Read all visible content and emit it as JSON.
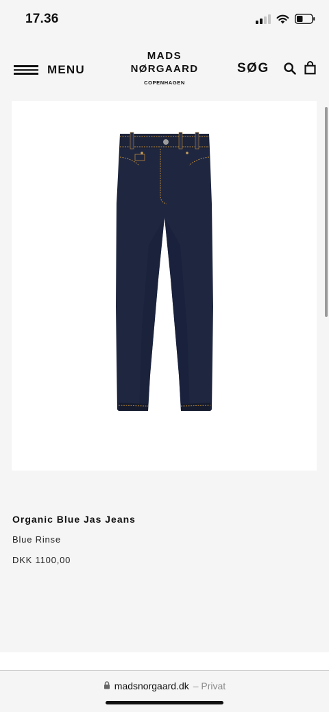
{
  "status": {
    "time": "17.36"
  },
  "header": {
    "menu_label": "MENU",
    "logo_line1": "MADS",
    "logo_line2": "NØRGAARD",
    "logo_line3": "COPENHAGEN",
    "search_label": "SØG",
    "search_icon": "search-icon",
    "bag_icon": "shopping-bag-icon",
    "menu_icon": "hamburger-icon"
  },
  "product": {
    "name": "Organic Blue Jas Jeans",
    "color": "Blue Rinse",
    "price": "DKK 1100,00",
    "image": "dark-blue-jeans"
  },
  "browser": {
    "domain": "madsnorgaard.dk",
    "mode": "– Privat",
    "lock_icon": "lock-icon"
  },
  "colors": {
    "background": "#f5f5f5",
    "denim": "#1f2740",
    "stitching": "#b8863a"
  }
}
